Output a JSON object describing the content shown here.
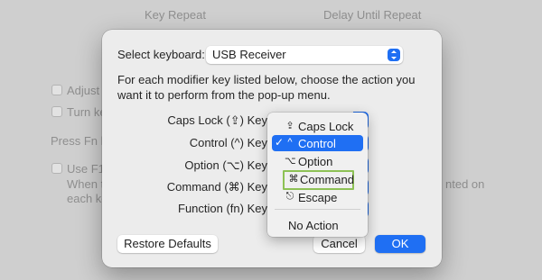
{
  "background": {
    "key_repeat": "Key Repeat",
    "delay_until_repeat": "Delay Until Repeat",
    "adjust": "Adjust",
    "turn": "Turn ke",
    "press_fn": "Press Fn k",
    "use_f1": "Use F1,",
    "when": "When t",
    "each_key": "each ke",
    "nted_on": "nted on"
  },
  "dialog": {
    "select_keyboard_label": "Select keyboard:",
    "keyboard_value": "USB Receiver",
    "description": "For each modifier key listed below, choose the action you want it to perform from the pop-up menu.",
    "rows": [
      {
        "label": "Caps Lock (⇪) Key"
      },
      {
        "label": "Control (^) Key"
      },
      {
        "label": "Option (⌥) Key"
      },
      {
        "label": "Command (⌘) Key"
      },
      {
        "label": "Function (fn) Key"
      }
    ],
    "restore_defaults": "Restore Defaults",
    "cancel": "Cancel",
    "ok": "OK"
  },
  "menu": {
    "items": [
      {
        "glyph": "⇪",
        "label": "Caps Lock",
        "checked": false
      },
      {
        "glyph": "^",
        "label": "Control",
        "checked": true
      },
      {
        "glyph": "⌥",
        "label": "Option",
        "checked": false
      },
      {
        "glyph": "⌘",
        "label": "Command",
        "checked": false
      },
      {
        "glyph": "⎋",
        "label": "Escape",
        "checked": false
      }
    ],
    "no_action": "No Action",
    "checkmark": "✓"
  },
  "colors": {
    "accent": "#1f6ff3",
    "highlight_border": "#8dc155"
  }
}
